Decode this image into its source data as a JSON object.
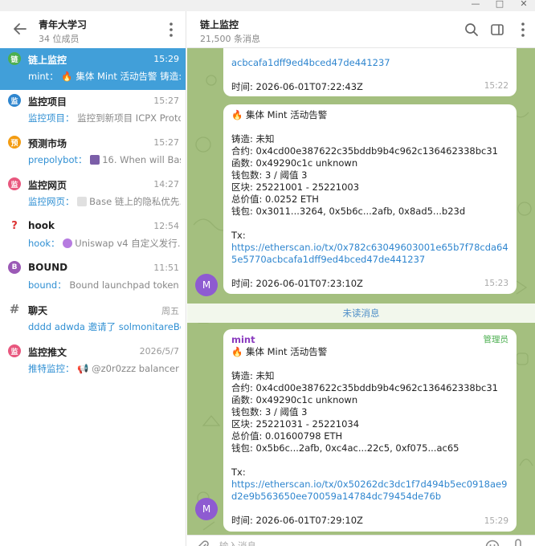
{
  "window": {
    "minimize": "—",
    "maximize": "□",
    "close": "✕"
  },
  "group": {
    "title": "青年大学习",
    "members": "34 位成员"
  },
  "chats": [
    {
      "name": "链上监控",
      "time": "15:29",
      "avatar_text": "链",
      "avatar_color": "#4caf50",
      "sender": "mint：",
      "preview": "🔥 集体 Mint 活动告警  铸造: 未知",
      "active": true
    },
    {
      "name": "监控项目",
      "time": "15:27",
      "avatar_text": "监",
      "avatar_color": "#2f86cf",
      "sender": "监控项目：",
      "preview": "监控到新项目 ICPX Proto…"
    },
    {
      "name": "预测市场",
      "time": "15:27",
      "avatar_text": "预",
      "avatar_color": "#f39c12",
      "sender": "prepolybot：",
      "preview": "16. When will Bas…"
    },
    {
      "name": "监控网页",
      "time": "14:27",
      "avatar_text": "监",
      "avatar_color": "#e8577e",
      "sender": "监控网页：",
      "preview": "Base 链上的隐私优先…"
    },
    {
      "name": "hook",
      "time": "12:54",
      "avatar_text": "?",
      "avatar_color": "#ffffff",
      "sender": "hook：",
      "preview": "Uniswap v4 自定义发行…"
    },
    {
      "name": "BOUND",
      "time": "11:51",
      "avatar_text": "B",
      "avatar_color": "#9b59b6",
      "sender": "bound：",
      "preview": "Bound launchpad token li…"
    },
    {
      "name": "聊天",
      "time": "周五",
      "avatar_text": "#",
      "avatar_color": "#ffffff",
      "sender": "",
      "preview": "dddd adwda 邀请了 solmonitareBot"
    },
    {
      "name": "监控推文",
      "time": "2026/5/7",
      "avatar_text": "监",
      "avatar_color": "#e8577e",
      "sender": "推特监控：",
      "preview": "📢 @z0r0zzz  balancer …"
    }
  ],
  "channel": {
    "title": "链上监控",
    "sub": "21,500 条消息"
  },
  "messages": {
    "m1": {
      "link_tail": "acbcafa1dff9ed4bced47de441237",
      "time_line": "时间: 2026-06-01T07:22:43Z",
      "time": "15:22"
    },
    "m2": {
      "lines": [
        "🔥 集体 Mint 活动告警",
        "",
        "铸造: 未知",
        "合约: 0x4cd00e387622c35bddb9b4c962c136462338bc31",
        "函数: 0x49290c1c unknown",
        "钱包数: 3 / 阈值 3",
        "区块: 25221001 - 25221003",
        "总价值: 0.0252 ETH",
        "钱包: 0x3011...3264, 0x5b6c...2afb, 0x8ad5...b23d",
        "",
        "Tx:"
      ],
      "link": "https://etherscan.io/tx/0x782c63049603001e65b7f78cda645e5770acbcafa1dff9ed4bced47de441237",
      "time_line": "时间: 2026-06-01T07:23:10Z",
      "time": "15:23",
      "avatar": "M"
    },
    "unread": "未读消息",
    "m3": {
      "sender": "mint",
      "role": "管理员",
      "lines": [
        "🔥 集体 Mint 活动告警",
        "",
        "铸造: 未知",
        "合约: 0x4cd00e387622c35bddb9b4c962c136462338bc31",
        "函数: 0x49290c1c unknown",
        "钱包数: 3 / 阈值 3",
        "区块: 25221031 - 25221034",
        "总价值: 0.01600798 ETH",
        "钱包: 0x5b6c...2afb, 0xc4ac...22c5, 0xf075...ac65",
        "",
        "Tx:"
      ],
      "link": "https://etherscan.io/tx/0x50262dc3dc1f7d494b5ec0918ae9d2e9b563650ee70059a14784dc79454de76b",
      "time_line": "时间: 2026-06-01T07:29:10Z",
      "time": "15:29",
      "avatar": "M"
    }
  },
  "composer": {
    "placeholder": "输入消息..."
  },
  "colors": {
    "accent": "#419fd9",
    "chat_bg": "#a4bf7f",
    "link": "#2f86cf",
    "admin": "#4caf50"
  }
}
